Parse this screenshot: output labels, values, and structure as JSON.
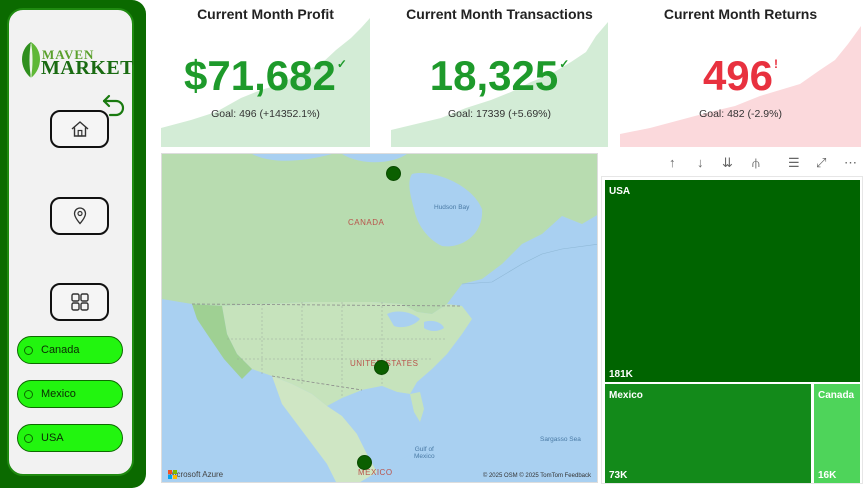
{
  "logo": {
    "top": "MAVEN",
    "bottom": "MARKET"
  },
  "sidebar": {
    "nav": [
      {
        "id": "home",
        "icon": "home-icon"
      },
      {
        "id": "map",
        "icon": "location-pin-icon"
      },
      {
        "id": "grid",
        "icon": "grid-icon"
      }
    ],
    "countries": [
      "Canada",
      "Mexico",
      "USA"
    ]
  },
  "kpis": [
    {
      "title": "Current Month Profit",
      "value": "$71,682",
      "mark": "✓",
      "goal": "Goal: 496 (+14352.1%)",
      "status": "good"
    },
    {
      "title": "Current Month Transactions",
      "value": "18,325",
      "mark": "✓",
      "goal": "Goal: 17339 (+5.69%)",
      "status": "good"
    },
    {
      "title": "Current Month Returns",
      "value": "496",
      "mark": "!",
      "goal": "Goal: 482 (-2.9%)",
      "status": "bad"
    }
  ],
  "colors": {
    "good_text": "#1e9a2b",
    "bad_text": "#e8313f",
    "good_spark": "#d3ecd6",
    "bad_spark": "#fbd9dc",
    "sidebar_bg": "#0b6a00",
    "pill": "#22f50f",
    "tile_usa": "#006400",
    "tile_mexico": "#138a1a",
    "tile_canada": "#4ed45a"
  },
  "map": {
    "labels": {
      "canada": "CANADA",
      "united_states": "UNITED STATES",
      "mexico": "MEXICO"
    },
    "seas": {
      "hudson": "Hudson Bay",
      "gulf": "Gulf of\nMexico",
      "sargasso": "Sargasso Sea"
    },
    "brand": "Microsoft Azure",
    "attribution": "© 2025 OSM  © 2025 TomTom  Feedback"
  },
  "treemap": {
    "tiles": [
      {
        "name": "USA",
        "label": "181K",
        "value": 181000
      },
      {
        "name": "Mexico",
        "label": "73K",
        "value": 73000
      },
      {
        "name": "Canada",
        "label": "16K",
        "value": 16000
      }
    ]
  },
  "toolbar": {
    "icons": [
      "arrow-up-icon",
      "arrow-down-icon",
      "double-arrow-down-icon",
      "expand-hierarchy-icon",
      "filter-icon",
      "focus-mode-icon",
      "more-options-icon"
    ]
  }
}
